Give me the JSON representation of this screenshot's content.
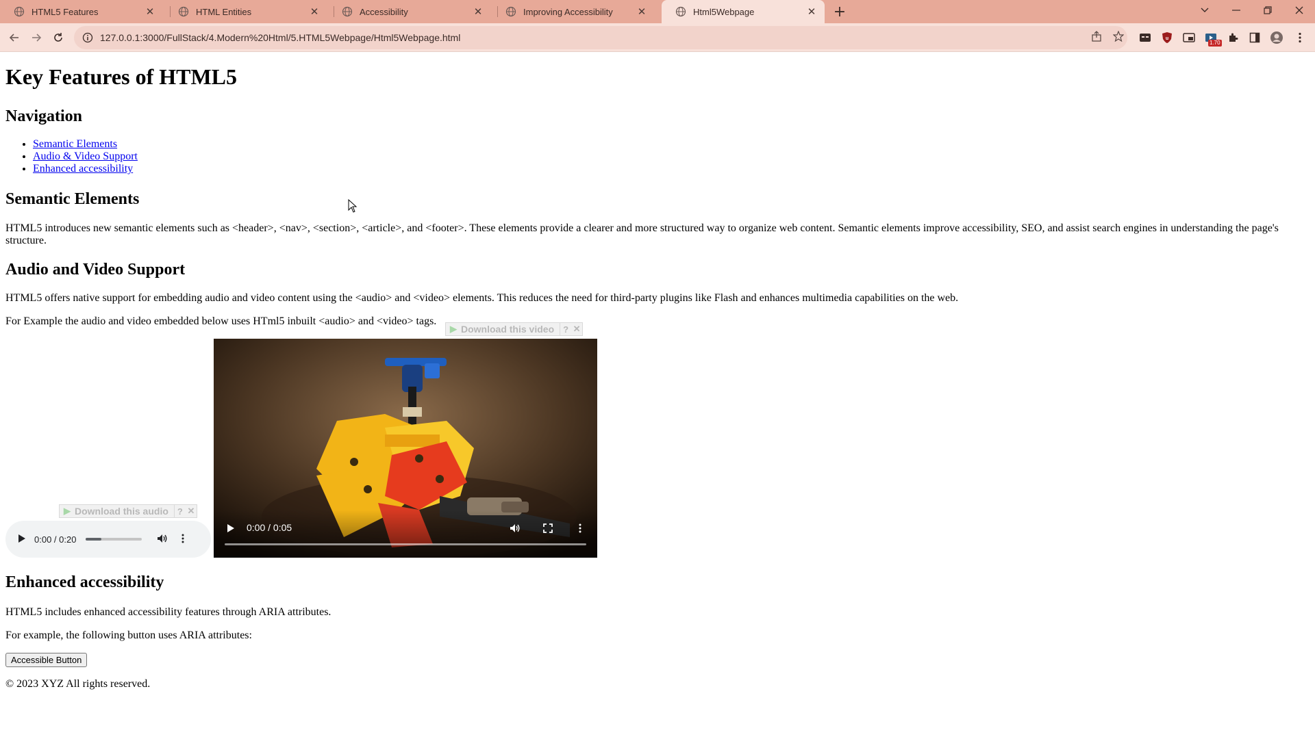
{
  "browser": {
    "tabs": [
      {
        "title": "HTML5 Features",
        "active": false
      },
      {
        "title": "HTML Entities",
        "active": false
      },
      {
        "title": "Accessibility",
        "active": false
      },
      {
        "title": "Improving Accessibility",
        "active": false
      },
      {
        "title": "Html5Webpage",
        "active": true
      }
    ],
    "url": "127.0.0.1:3000/FullStack/4.Modern%20Html/5.HTML5Webpage/Html5Webpage.html",
    "extension_badge": "1.70",
    "colors": {
      "tabbar": "#e7a998",
      "toolbar": "#f8e1da",
      "omnibox": "#f2d3cb"
    }
  },
  "page": {
    "title": "Key Features of HTML5",
    "nav_heading": "Navigation",
    "nav_links": [
      "Semantic Elements",
      "Audio & Video Support",
      "Enhanced accessibility"
    ],
    "semantic": {
      "heading": "Semantic Elements",
      "text": "HTML5 introduces new semantic elements such as <header>, <nav>, <section>, <article>, and <footer>. These elements provide a clearer and more structured way to organize web content. Semantic elements improve accessibility, SEO, and assist search engines in understanding the page's structure."
    },
    "media": {
      "heading": "Audio and Video Support",
      "text": "HTML5 offers native support for embedding audio and video content using the <audio> and <video> elements. This reduces the need for third-party plugins like Flash and enhances multimedia capabilities on the web.",
      "example": "For Example the audio and video embedded below uses HTml5 inbuilt <audio> and <video> tags.",
      "download_video": "Download this video",
      "download_audio": "Download this audio",
      "audio_time": "0:00 / 0:20",
      "audio_progress": 0.27,
      "video_time": "0:00 / 0:05"
    },
    "accessibility": {
      "heading": "Enhanced accessibility",
      "text": "HTML5 includes enhanced accessibility features through ARIA attributes.",
      "example": "For example, the following button uses ARIA attributes:",
      "button": "Accessible Button"
    },
    "footer": "© 2023 XYZ All rights reserved."
  }
}
